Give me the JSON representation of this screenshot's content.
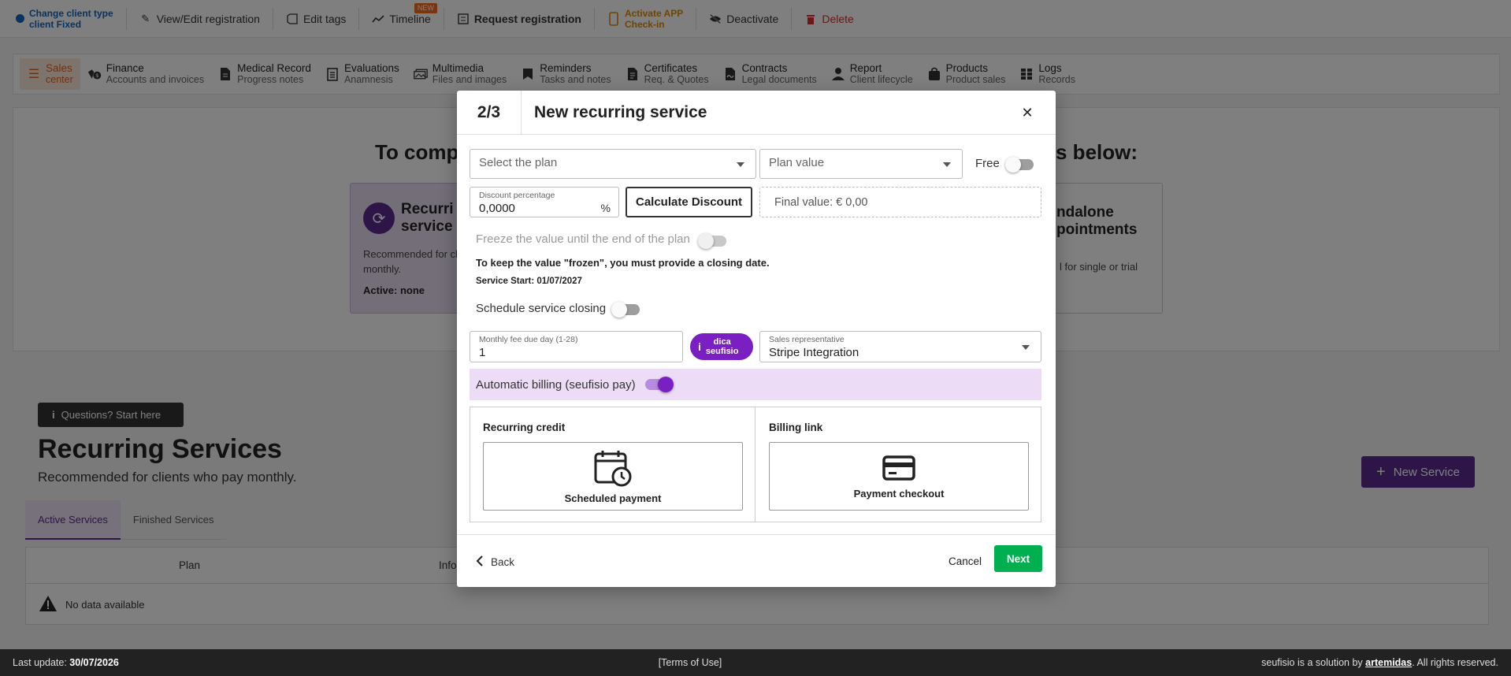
{
  "topbar": {
    "client_type_line1": "Change client type",
    "client_type_line2": "client Fixed",
    "view_edit": "View/Edit registration",
    "edit_tags": "Edit tags",
    "timeline": "Timeline",
    "timeline_badge": "NEW",
    "request_registration": "Request registration",
    "activate_line1": "Activate APP",
    "activate_line2": "Check-in",
    "deactivate": "Deactivate",
    "delete": "Delete"
  },
  "nav": {
    "items": [
      {
        "title": "Sales",
        "sub": "center",
        "icon": "menu-icon"
      },
      {
        "title": "Finance",
        "sub": "Accounts and invoices",
        "icon": "finance-icon"
      },
      {
        "title": "Medical Record",
        "sub": "Progress notes",
        "icon": "document-icon"
      },
      {
        "title": "Evaluations",
        "sub": "Anamnesis",
        "icon": "clipboard-icon"
      },
      {
        "title": "Multimedia",
        "sub": "Files and images",
        "icon": "images-icon"
      },
      {
        "title": "Reminders",
        "sub": "Tasks and notes",
        "icon": "bookmark-icon"
      },
      {
        "title": "Certificates",
        "sub": "Req. & Quotes",
        "icon": "certificate-icon"
      },
      {
        "title": "Contracts",
        "sub": "Legal documents",
        "icon": "contract-icon"
      },
      {
        "title": "Report",
        "sub": "Client lifecycle",
        "icon": "person-icon"
      },
      {
        "title": "Products",
        "sub": "Product sales",
        "icon": "bag-icon"
      },
      {
        "title": "Logs",
        "sub": "Records",
        "icon": "grid-icon"
      }
    ]
  },
  "background": {
    "heading_left": "To comp",
    "heading_right": "s below:",
    "card_left_title_1": "Recurri",
    "card_left_title_2": "service",
    "card_left_desc_1": "Recommended for cl",
    "card_left_desc_2": "monthly.",
    "card_left_active": "Active: none",
    "card_right_title_1": "ndalone",
    "card_right_title_2": "pointments",
    "card_right_desc": "l for single or trial",
    "questions_button": "Questions? Start here",
    "recurring_title": "Recurring Services",
    "recurring_sub": "Recommended for clients who pay monthly.",
    "new_service_button": "New Service",
    "tabs": [
      "Active Services",
      "Finished Services"
    ],
    "table_headers": [
      "Plan",
      "Info"
    ],
    "no_data": "No data available"
  },
  "modal": {
    "step": "2/3",
    "title": "New recurring service",
    "plan_placeholder": "Select the plan",
    "plan_value_placeholder": "Plan value",
    "free_label": "Free",
    "free_on": false,
    "discount_label": "Discount percentage",
    "discount_value": "0,0000",
    "discount_suffix": "%",
    "calculate_button": "Calculate Discount",
    "final_value": "Final value: € 0,00",
    "freeze_label": "Freeze the value until the end of the plan",
    "freeze_warning": "To keep the value \"frozen\", you must provide a closing date.",
    "service_start": "Service Start: 01/07/2027",
    "schedule_closing_label": "Schedule service closing",
    "due_day_label": "Monthly fee due day (1-28)",
    "due_day_value": "1",
    "dica_line1": "dica",
    "dica_line2": "seufisio",
    "sales_rep_label": "Sales representative",
    "sales_rep_value": "Stripe Integration",
    "auto_billing_label": "Automatic billing (seufisio pay)",
    "auto_billing_on": true,
    "recurring_credit_header": "Recurring credit",
    "scheduled_payment": "Scheduled payment",
    "billing_link_header": "Billing link",
    "payment_checkout": "Payment checkout",
    "back": "Back",
    "cancel": "Cancel",
    "next": "Next"
  },
  "footer": {
    "last_update_label": "Last update:",
    "last_update_value": "30/07/2026",
    "terms": "[Terms of Use]",
    "credit_prefix": "seufisio is a solution by",
    "credit_brand": "artemidas",
    "credit_suffix": ". All rights reserved."
  },
  "colors": {
    "brand_purple": "#5b2a91",
    "accent_orange": "#e0631d",
    "next_green": "#00b050",
    "delete_red": "#d32f2f"
  }
}
